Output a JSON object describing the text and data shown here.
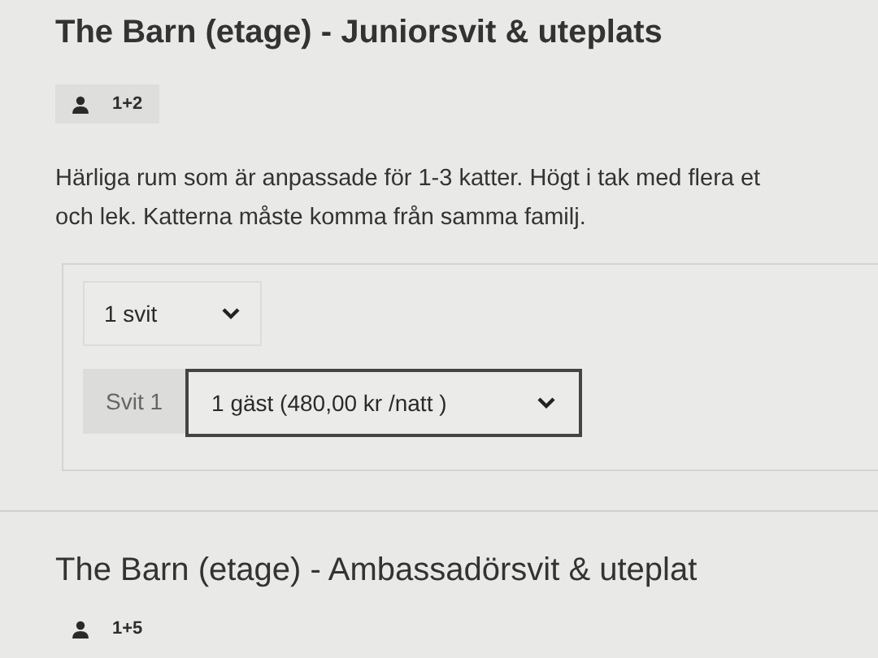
{
  "rooms": [
    {
      "title": "The Barn (etage) - Juniorsvit & uteplats",
      "capacity": "1+2",
      "description": "Härliga rum som är anpassade för 1-3 katter. Högt i tak med flera et\noch lek. Katterna måste komma från samma familj.",
      "suite_select": {
        "value": "1 svit"
      },
      "suites": [
        {
          "label": "Svit 1",
          "guest_select": {
            "value": "1 gäst (480,00 kr /natt )"
          }
        }
      ]
    },
    {
      "title": "The Barn (etage) - Ambassadörsvit & uteplat",
      "capacity": "1+5"
    }
  ]
}
